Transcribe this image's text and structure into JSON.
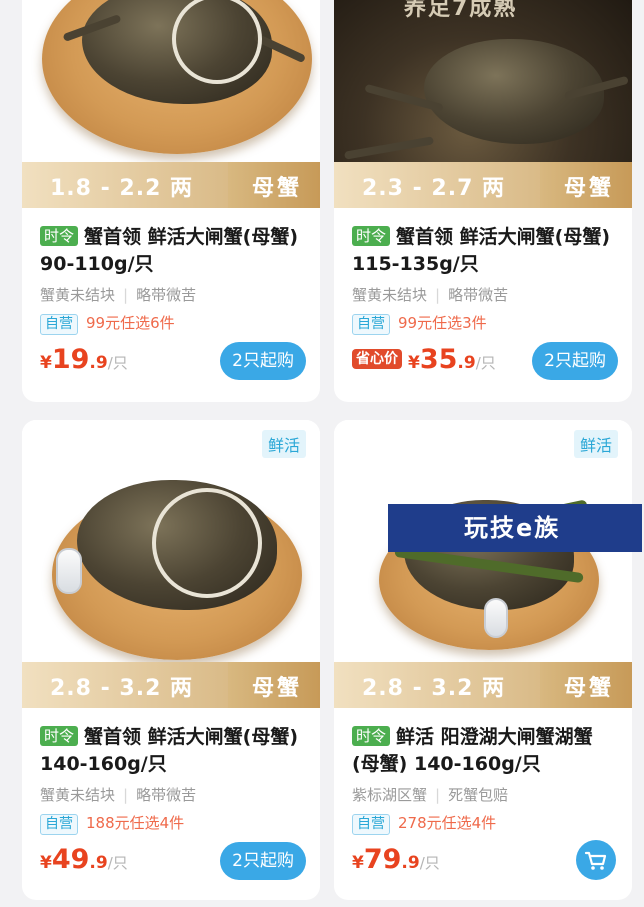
{
  "products": [
    {
      "weight_range": "1.8 - 2.2 两",
      "gender": "母蟹",
      "time_badge": "时令",
      "title": "蟹首领 鲜活大闸蟹(母蟹) 90-110g/只",
      "attr1": "蟹黄未结块",
      "attr2": "略带微苦",
      "self_badge": "自营",
      "promo": "99元任选6件",
      "price_currency": "¥",
      "price_int": "19",
      "price_dec": ".9",
      "price_unit": "/只",
      "action_label": "2只起购"
    },
    {
      "photo_overlay": "养足7成熟",
      "weight_range": "2.3 - 2.7 两",
      "gender": "母蟹",
      "time_badge": "时令",
      "title": "蟹首领 鲜活大闸蟹(母蟹) 115-135g/只",
      "attr1": "蟹黄未结块",
      "attr2": "略带微苦",
      "self_badge": "自营",
      "promo": "99元任选3件",
      "price_badge": "省心价",
      "price_currency": "¥",
      "price_int": "35",
      "price_dec": ".9",
      "price_unit": "/只",
      "action_label": "2只起购"
    },
    {
      "fresh_badge": "鲜活",
      "weight_range": "2.8 - 3.2 两",
      "gender": "母蟹",
      "time_badge": "时令",
      "title": "蟹首领 鲜活大闸蟹(母蟹) 140-160g/只",
      "attr1": "蟹黄未结块",
      "attr2": "略带微苦",
      "self_badge": "自营",
      "promo": "188元任选4件",
      "price_currency": "¥",
      "price_int": "49",
      "price_dec": ".9",
      "price_unit": "/只",
      "action_label": "2只起购"
    },
    {
      "fresh_badge": "鲜活",
      "weight_range": "2.8 - 3.2 两",
      "gender": "母蟹",
      "time_badge": "时令",
      "title": "鲜活 阳澄湖大闸蟹湖蟹(母蟹) 140-160g/只",
      "attr1": "紫标湖区蟹",
      "attr2": "死蟹包赔",
      "self_badge": "自营",
      "promo": "278元任选4件",
      "price_currency": "¥",
      "price_int": "79",
      "price_dec": ".9",
      "price_unit": "/只",
      "action_icon": "cart-icon"
    }
  ],
  "watermark": "玩技e族",
  "colors": {
    "price": "#e8431f",
    "action_button": "#3aa8e6",
    "time_badge": "#4cae4f",
    "self_badge": "#2aa7d6"
  }
}
